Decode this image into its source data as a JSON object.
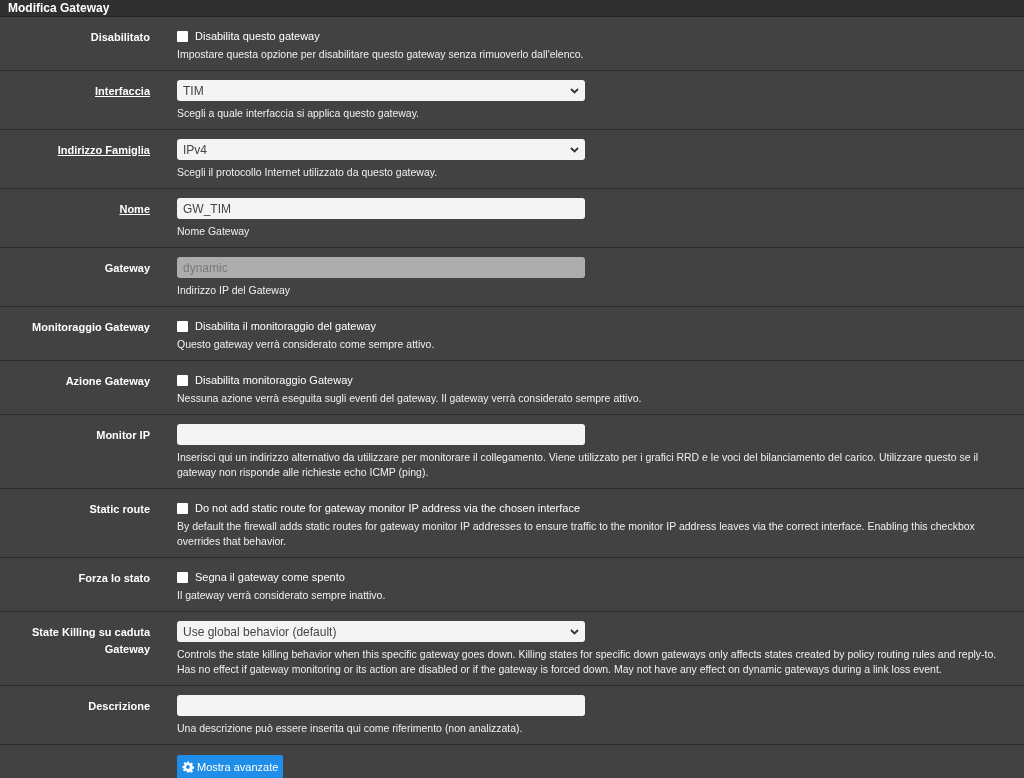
{
  "title": "Modifica Gateway",
  "rows": [
    {
      "kind": "checkbox",
      "label": "Disabilitato",
      "required": false,
      "checked": false,
      "option": "Disabilita questo gateway",
      "help": "Impostare questa opzione per disabilitare questo gateway senza rimuoverlo dall'elenco."
    },
    {
      "kind": "select",
      "label": "Interfaccia",
      "required": true,
      "value": "TIM",
      "help": "Scegli a quale interfaccia si applica questo gateway."
    },
    {
      "kind": "select",
      "label": "Indirizzo Famiglia",
      "required": true,
      "value": "IPv4",
      "help": "Scegli il protocollo Internet utilizzato da questo gateway."
    },
    {
      "kind": "input",
      "label": "Nome",
      "required": true,
      "disabled": false,
      "value": "GW_TIM",
      "help": "Nome Gateway"
    },
    {
      "kind": "input",
      "label": "Gateway",
      "required": false,
      "disabled": true,
      "value": "dynamic",
      "help": "Indirizzo IP del Gateway"
    },
    {
      "kind": "checkbox",
      "label": "Monitoraggio Gateway",
      "required": false,
      "checked": false,
      "option": "Disabilita il monitoraggio del gateway",
      "help": "Questo gateway verrà considerato come sempre attivo."
    },
    {
      "kind": "checkbox",
      "label": "Azione Gateway",
      "required": false,
      "checked": false,
      "option": "Disabilita monitoraggio Gateway",
      "help": "Nessuna azione verrà eseguita sugli eventi del gateway. Il gateway verrà considerato sempre attivo."
    },
    {
      "kind": "input",
      "label": "Monitor IP",
      "required": false,
      "disabled": false,
      "help": "Inserisci qui un indirizzo alternativo da utilizzare per monitorare il collegamento. Viene utilizzato per i grafici RRD e le voci del bilanciamento del carico. Utilizzare questo se il gateway non risponde alle richieste echo ICMP (ping)."
    },
    {
      "kind": "checkbox",
      "label": "Static route",
      "required": false,
      "checked": false,
      "option": "Do not add static route for gateway monitor IP address via the chosen interface",
      "help": "By default the firewall adds static routes for gateway monitor IP addresses to ensure traffic to the monitor IP address leaves via the correct interface. Enabling this checkbox overrides that behavior."
    },
    {
      "kind": "checkbox",
      "label": "Forza lo stato",
      "required": false,
      "checked": false,
      "option": "Segna il gateway come spento",
      "help": "Il gateway verrà considerato sempre inattivo."
    },
    {
      "kind": "select",
      "label": "State Killing su caduta Gateway",
      "required": false,
      "value": "Use global behavior (default)",
      "help": "Controls the state killing behavior when this specific gateway goes down. Killing states for specific down gateways only affects states created by policy routing rules and reply-to. Has no effect if gateway monitoring or its action are disabled or if the gateway is forced down. May not have any effect on dynamic gateways during a link loss event."
    },
    {
      "kind": "input",
      "label": "Descrizione",
      "required": false,
      "disabled": false,
      "help": "Una descrizione può essere inserita qui come riferimento (non analizzata)."
    }
  ],
  "button": {
    "label": "Mostra avanzate"
  }
}
